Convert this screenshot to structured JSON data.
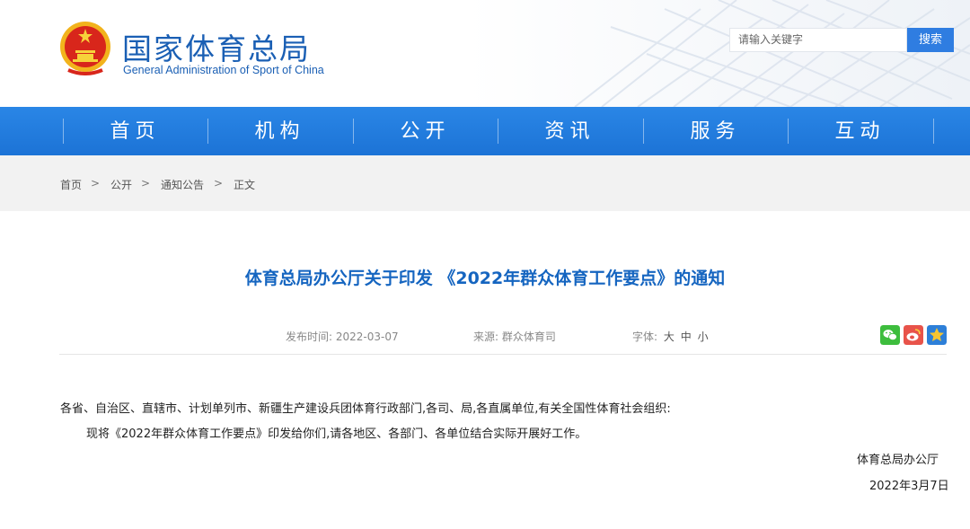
{
  "site": {
    "name_cn": "国家体育总局",
    "name_en": "General Administration of Sport of China"
  },
  "search": {
    "placeholder": "请输入关键字",
    "button": "搜索"
  },
  "nav": [
    {
      "label": "首页"
    },
    {
      "label": "机构"
    },
    {
      "label": "公开"
    },
    {
      "label": "资讯"
    },
    {
      "label": "服务"
    },
    {
      "label": "互动"
    }
  ],
  "breadcrumb": [
    "首页",
    "公开",
    "通知公告",
    "正文"
  ],
  "breadcrumb_sep": ">",
  "article": {
    "title": "体育总局办公厅关于印发 《2022年群众体育工作要点》的通知",
    "meta": {
      "date_label": "发布时间:",
      "date": "2022-03-07",
      "source_label": "来源:",
      "source": "群众体育司",
      "font_label": "字体:",
      "font_sizes": [
        "大",
        "中",
        "小"
      ]
    },
    "share_icons": [
      "wechat-icon",
      "weibo-icon",
      "favorite-star-icon"
    ],
    "body": [
      "各省、自治区、直辖市、计划单列市、新疆生产建设兵团体育行政部门,各司、局,各直属单位,有关全国性体育社会组织:",
      "现将《2022年群众体育工作要点》印发给你们,请各地区、各部门、各单位结合实际开展好工作。"
    ],
    "signature": "体育总局办公厅",
    "sign_date": "2022年3月7日"
  },
  "colors": {
    "brand_blue": "#1a5fb4",
    "nav_blue": "#1c73d6",
    "title_blue": "#1565c0",
    "search_btn": "#2f7de1",
    "wechat_green": "#3dbd3d",
    "weibo_red": "#e8534a",
    "star_bg": "#2d7fd8"
  }
}
